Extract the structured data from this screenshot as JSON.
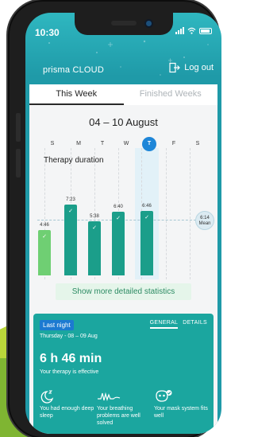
{
  "status": {
    "time": "10:30"
  },
  "header": {
    "brand": "prisma CLOUD",
    "logout_label": "Log out"
  },
  "tabs": [
    {
      "label": "This Week",
      "active": true
    },
    {
      "label": "Finished Weeks",
      "active": false
    }
  ],
  "week_range": "04 – 10 August",
  "weekdays": [
    "S",
    "M",
    "T",
    "W",
    "T",
    "F",
    "S"
  ],
  "selected_day_index": 4,
  "chart_data": {
    "type": "bar",
    "title": "Therapy duration",
    "categories": [
      "S",
      "M",
      "T",
      "W",
      "T",
      "F",
      "S"
    ],
    "value_labels": [
      "4:46",
      "7:23",
      "5:38",
      "6:40",
      "6:46"
    ],
    "values_hours": [
      4.77,
      7.38,
      5.63,
      6.67,
      6.77
    ],
    "bar_colors": [
      "#6fcf73",
      "#1b9e8a",
      "#1b9e8a",
      "#1b9e8a",
      "#1b9e8a"
    ],
    "mean_value": "6:14",
    "mean_label": "Mean"
  },
  "stats_button_label": "Show more detailed statistics",
  "last_night": {
    "badge": "Last night",
    "date": "Thursday - 08 – 09 Aug",
    "tabs": [
      "GENERAL",
      "DETAILS"
    ],
    "total": "6 h 46 min",
    "subtitle": "Your therapy is effective",
    "metrics": [
      {
        "icon": "moon-zzz-icon",
        "text": "You had enough deep sleep"
      },
      {
        "icon": "breathing-wave-icon",
        "text": "Your breathing problems are well solved"
      },
      {
        "icon": "mask-check-icon",
        "text": "Your mask system fits well"
      }
    ]
  }
}
